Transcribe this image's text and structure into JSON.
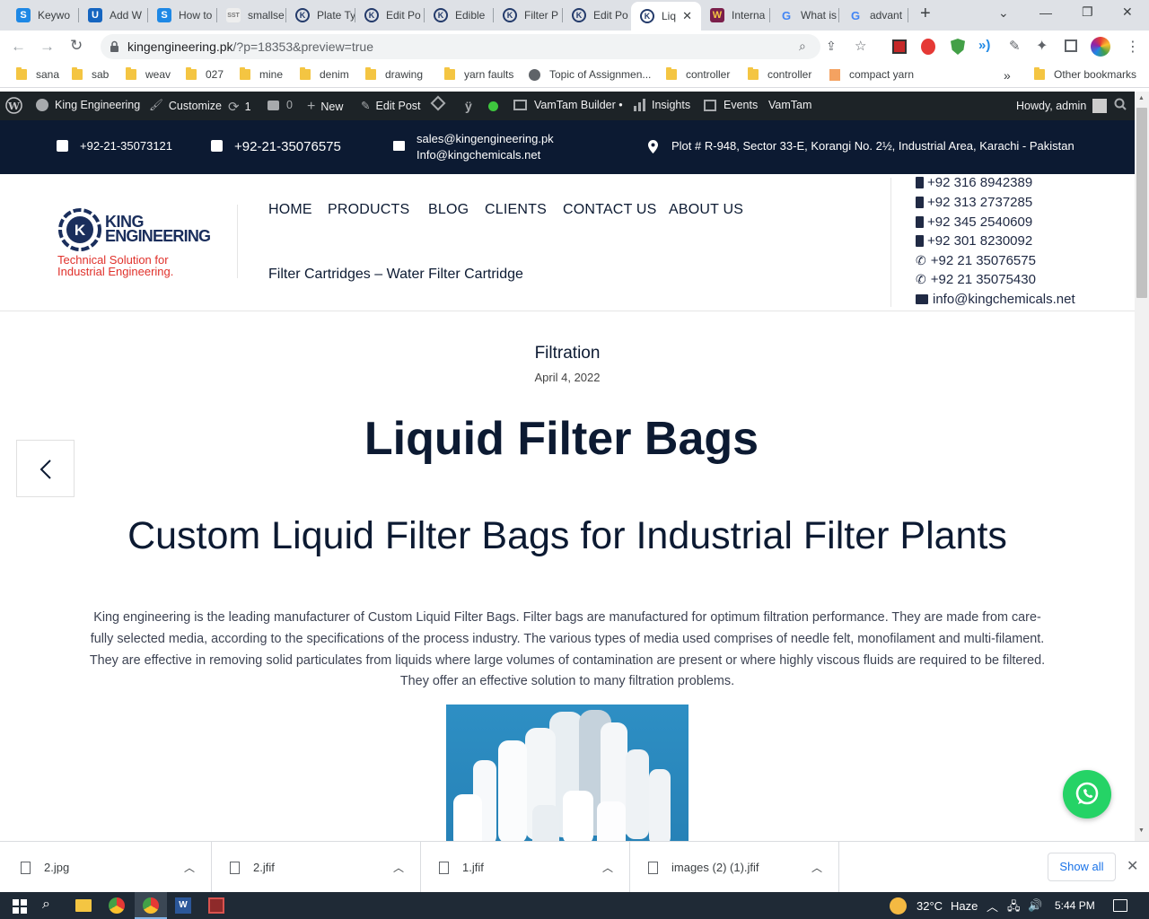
{
  "browser": {
    "tabs": [
      {
        "label": "Keywo",
        "icon": "s-icon"
      },
      {
        "label": "Add W",
        "icon": "u-icon"
      },
      {
        "label": "How to",
        "icon": "s-icon"
      },
      {
        "label": "smallse",
        "icon": "sst-icon"
      },
      {
        "label": "Plate Ty",
        "icon": "k-icon"
      },
      {
        "label": "Edit Po",
        "icon": "k-icon"
      },
      {
        "label": "Edible",
        "icon": "k-icon"
      },
      {
        "label": "Filter P",
        "icon": "k-icon"
      },
      {
        "label": "Edit Po",
        "icon": "k-icon"
      },
      {
        "label": "Liq",
        "icon": "k-icon",
        "active": true
      },
      {
        "label": "Interna",
        "icon": "w-icon"
      },
      {
        "label": "What is",
        "icon": "google-icon"
      },
      {
        "label": "advant",
        "icon": "google-icon"
      }
    ],
    "url_host": "kingengineering.pk",
    "url_path": "/?p=18353&preview=true",
    "bookmarks": [
      "sana",
      "sab",
      "weav",
      "027",
      "mine",
      "denim",
      "drawing",
      "yarn faults",
      "Topic of Assignmen...",
      "controller",
      "controller",
      "compact yarn"
    ],
    "bookmarks_more": "»",
    "other_bookmarks": "Other bookmarks"
  },
  "wpbar": {
    "site": "King Engineering",
    "customize": "Customize",
    "updates": "1",
    "comments": "0",
    "new": "New",
    "edit_post": "Edit Post",
    "builder": "VamTam Builder •",
    "insights": "Insights",
    "events": "Events",
    "vamtam": "VamTam",
    "howdy": "Howdy, admin"
  },
  "sitetop": {
    "phone1": "+92-21-35073121",
    "phone2": "+92-21-35076575",
    "email1": "sales@kingengineering.pk",
    "email2": "Info@kingchemicals.net",
    "address": "Plot # R-948, Sector 33-E, Korangi No. 2½, Industrial Area, Karachi - Pakistan"
  },
  "header": {
    "logo_line1": "KING",
    "logo_line2": "ENGINEERING",
    "tagline1": "Technical Solution for",
    "tagline2": "Industrial Engineering.",
    "nav": [
      "HOME",
      "PRODUCTS",
      "BLOG",
      "CLIENTS",
      "CONTACT US",
      "ABOUT US"
    ],
    "subnav": "Filter Cartridges – Water Filter Cartridge",
    "mobiles": [
      "+92 316 8942389",
      "+92 313 2737285",
      "+92 345 2540609",
      "+92 301 8230092"
    ],
    "landlines": [
      "+92 21 35076575",
      "+92 21 35075430"
    ],
    "email": "info@kingchemicals.net"
  },
  "article": {
    "category": "Filtration",
    "date": "April 4, 2022",
    "title": "Liquid Filter Bags",
    "subtitle": "Custom Liquid Filter Bags for Industrial Filter Plants",
    "p1": "King engineering is the leading manufacturer of Custom Liquid Filter Bags.  Filter bags are manufactured for optimum filtration performance. They are made from care-",
    "p2": "fully selected media, according to the specifications of the process industry. The various types of media used comprises of needle felt, monofilament and multi-filament.",
    "p3": "They are effective in removing solid particulates from liquids where large volumes of contamination are present or where highly viscous fluids are required to be filtered.",
    "p4": "They offer an effective solution to many filtration problems."
  },
  "downloads": {
    "items": [
      "2.jpg",
      "2.jfif",
      "1.jfif",
      "images (2) (1).jfif"
    ],
    "show_all": "Show all"
  },
  "taskbar": {
    "temp": "32°C",
    "weather": "Haze",
    "time": "5:44 PM"
  },
  "colors": {
    "navy": "#0c1a32",
    "wp_bar": "#1d2327",
    "accent_red": "#e0312b",
    "whatsapp": "#25d366"
  }
}
